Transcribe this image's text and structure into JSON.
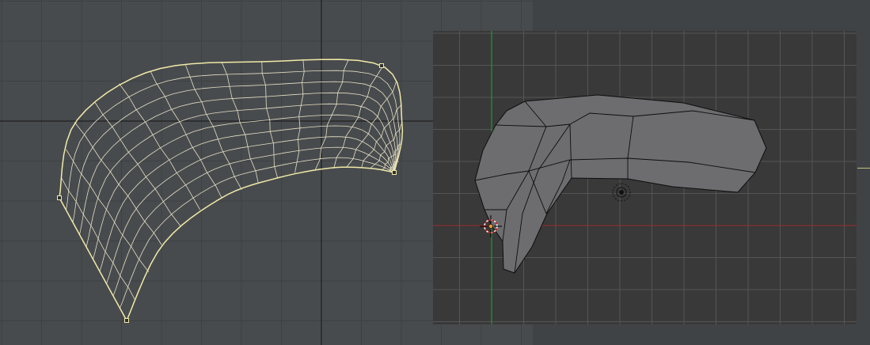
{
  "colors": {
    "uv_background": "#484b4e",
    "uv_grid": "#3e4144",
    "uv_axis": "#1e1f20",
    "uv_mesh": "#e4e0c4",
    "uv_boundary": "#f1eaa7",
    "view3d_background": "#393939",
    "view3d_grid": "#555555",
    "x_axis": "#9b2a2a",
    "y_axis": "#1f9a2a",
    "mesh_fill": "#6d6d70",
    "mesh_edges": "#0d0d0d"
  },
  "icons": {
    "cursor": "3d-cursor-icon",
    "origin": "object-origin-icon",
    "lamp": "lamp-icon"
  }
}
